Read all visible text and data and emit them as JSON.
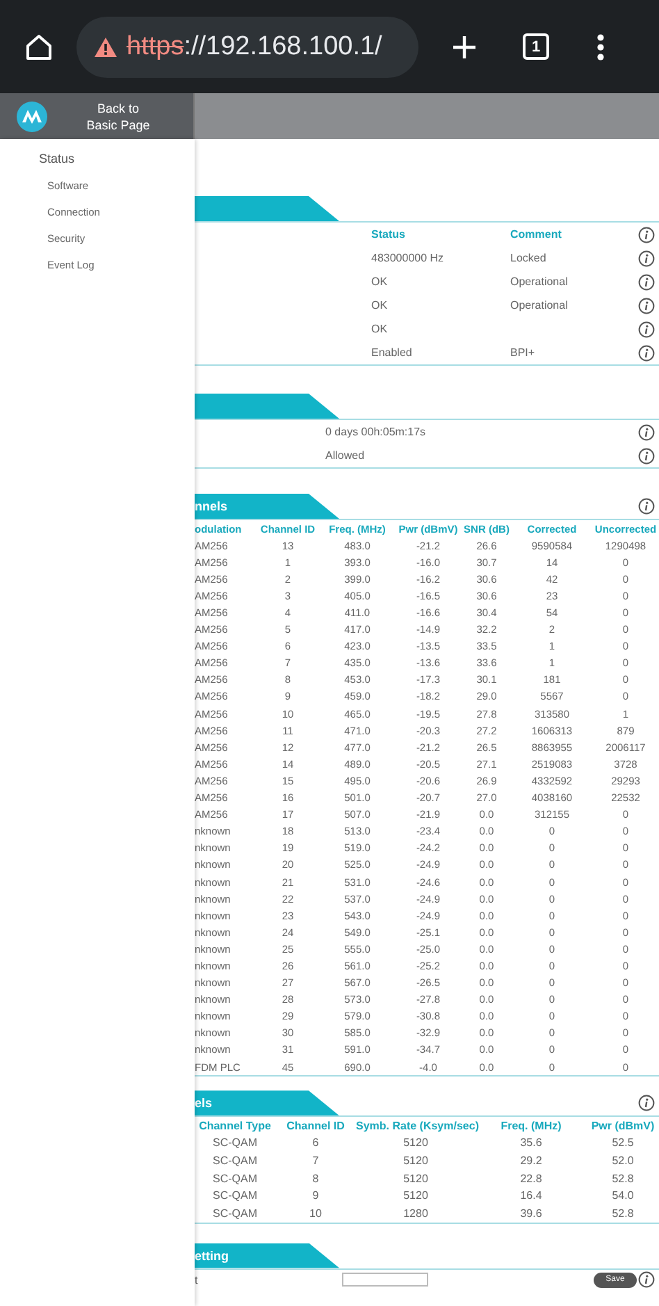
{
  "browser": {
    "insecure": true,
    "url_scheme": "https",
    "url_rest": "://192.168.100.1/",
    "tab_count": "1"
  },
  "header": {
    "back_link": "Back to Basic Page"
  },
  "sidebar": {
    "title": "Status",
    "items": [
      "Software",
      "Connection",
      "Security",
      "Event Log"
    ]
  },
  "sections": [
    {
      "kind": "status_table",
      "columns": [
        "Status",
        "Comment"
      ],
      "rows": [
        {
          "status": "483000000 Hz",
          "comment": "Locked"
        },
        {
          "status": "OK",
          "comment": "Operational"
        },
        {
          "status": "OK",
          "comment": "Operational"
        },
        {
          "status": "OK"
        },
        {
          "status": "Enabled",
          "comment": "BPI+"
        }
      ]
    },
    {
      "kind": "value_list",
      "rows": [
        "0 days 00h:05m:17s",
        "Allowed"
      ]
    },
    {
      "kind": "grid",
      "title": "nnels",
      "columns": [
        "odulation",
        "Channel ID",
        "Freq. (MHz)",
        "Pwr (dBmV)",
        "SNR (dB)",
        "Corrected",
        "Uncorrected"
      ],
      "rows": [
        [
          "AM256",
          "13",
          "483.0",
          "-21.2",
          "26.6",
          "9590584",
          "1290498"
        ],
        [
          "AM256",
          "1",
          "393.0",
          "-16.0",
          "30.7",
          "14",
          "0"
        ],
        [
          "AM256",
          "2",
          "399.0",
          "-16.2",
          "30.6",
          "42",
          "0"
        ],
        [
          "AM256",
          "3",
          "405.0",
          "-16.5",
          "30.6",
          "23",
          "0"
        ],
        [
          "AM256",
          "4",
          "411.0",
          "-16.6",
          "30.4",
          "54",
          "0"
        ],
        [
          "AM256",
          "5",
          "417.0",
          "-14.9",
          "32.2",
          "2",
          "0"
        ],
        [
          "AM256",
          "6",
          "423.0",
          "-13.5",
          "33.5",
          "1",
          "0"
        ],
        [
          "AM256",
          "7",
          "435.0",
          "-13.6",
          "33.6",
          "1",
          "0"
        ],
        [
          "AM256",
          "8",
          "453.0",
          "-17.3",
          "30.1",
          "181",
          "0"
        ],
        [
          "AM256",
          "9",
          "459.0",
          "-18.2",
          "29.0",
          "5567",
          "0"
        ],
        [
          "AM256",
          "10",
          "465.0",
          "-19.5",
          "27.8",
          "313580",
          "1"
        ],
        [
          "AM256",
          "11",
          "471.0",
          "-20.3",
          "27.2",
          "1606313",
          "879"
        ],
        [
          "AM256",
          "12",
          "477.0",
          "-21.2",
          "26.5",
          "8863955",
          "2006117"
        ],
        [
          "AM256",
          "14",
          "489.0",
          "-20.5",
          "27.1",
          "2519083",
          "3728"
        ],
        [
          "AM256",
          "15",
          "495.0",
          "-20.6",
          "26.9",
          "4332592",
          "29293"
        ],
        [
          "AM256",
          "16",
          "501.0",
          "-20.7",
          "27.0",
          "4038160",
          "22532"
        ],
        [
          "AM256",
          "17",
          "507.0",
          "-21.9",
          "0.0",
          "312155",
          "0"
        ],
        [
          "nknown",
          "18",
          "513.0",
          "-23.4",
          "0.0",
          "0",
          "0"
        ],
        [
          "nknown",
          "19",
          "519.0",
          "-24.2",
          "0.0",
          "0",
          "0"
        ],
        [
          "nknown",
          "20",
          "525.0",
          "-24.9",
          "0.0",
          "0",
          "0"
        ],
        [
          "nknown",
          "21",
          "531.0",
          "-24.6",
          "0.0",
          "0",
          "0"
        ],
        [
          "nknown",
          "22",
          "537.0",
          "-24.9",
          "0.0",
          "0",
          "0"
        ],
        [
          "nknown",
          "23",
          "543.0",
          "-24.9",
          "0.0",
          "0",
          "0"
        ],
        [
          "nknown",
          "24",
          "549.0",
          "-25.1",
          "0.0",
          "0",
          "0"
        ],
        [
          "nknown",
          "25",
          "555.0",
          "-25.0",
          "0.0",
          "0",
          "0"
        ],
        [
          "nknown",
          "26",
          "561.0",
          "-25.2",
          "0.0",
          "0",
          "0"
        ],
        [
          "nknown",
          "27",
          "567.0",
          "-26.5",
          "0.0",
          "0",
          "0"
        ],
        [
          "nknown",
          "28",
          "573.0",
          "-27.8",
          "0.0",
          "0",
          "0"
        ],
        [
          "nknown",
          "29",
          "579.0",
          "-30.8",
          "0.0",
          "0",
          "0"
        ],
        [
          "nknown",
          "30",
          "585.0",
          "-32.9",
          "0.0",
          "0",
          "0"
        ],
        [
          "nknown",
          "31",
          "591.0",
          "-34.7",
          "0.0",
          "0",
          "0"
        ],
        [
          "FDM PLC",
          "45",
          "690.0",
          "-4.0",
          "0.0",
          "0",
          "0"
        ]
      ]
    },
    {
      "kind": "grid",
      "title": "els",
      "columns": [
        "Channel Type",
        "Channel ID",
        "Symb. Rate (Ksym/sec)",
        "Freq. (MHz)",
        "Pwr (dBmV)"
      ],
      "rows": [
        [
          "SC-QAM",
          "6",
          "5120",
          "35.6",
          "52.5"
        ],
        [
          "SC-QAM",
          "7",
          "5120",
          "29.2",
          "52.0"
        ],
        [
          "SC-QAM",
          "8",
          "5120",
          "22.8",
          "52.8"
        ],
        [
          "SC-QAM",
          "9",
          "5120",
          "16.4",
          "54.0"
        ],
        [
          "SC-QAM",
          "10",
          "1280",
          "39.6",
          "52.8"
        ]
      ]
    },
    {
      "kind": "form",
      "title": "etting",
      "label": "t",
      "button": "Save"
    }
  ]
}
